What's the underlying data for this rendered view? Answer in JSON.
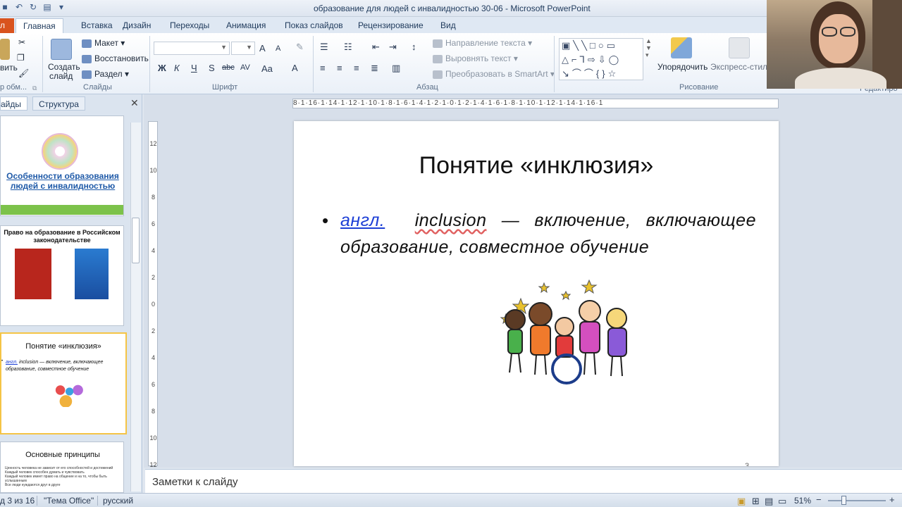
{
  "window": {
    "title": "образование для людей с инвалидностью 30-06  -  Microsoft PowerPoint"
  },
  "tabs": [
    {
      "label": "Главная"
    },
    {
      "label": "Вставка"
    },
    {
      "label": "Дизайн"
    },
    {
      "label": "Переходы"
    },
    {
      "label": "Анимация"
    },
    {
      "label": "Показ слайдов"
    },
    {
      "label": "Рецензирование"
    },
    {
      "label": "Вид"
    }
  ],
  "file_tab": {
    "label": "л"
  },
  "ribbon": {
    "clipboard": {
      "paste_label": "вить",
      "group_label": "р обм..."
    },
    "slides": {
      "create_label": "Создать",
      "create_label2": "слайд",
      "layout_label": "Макет",
      "reset_label": "Восстановить",
      "section_label": "Раздел",
      "group_label": "Слайды"
    },
    "font": {
      "group_label": "Шрифт",
      "bold": "Ж",
      "italic": "К",
      "underline": "Ч",
      "strike": "S",
      "abc": "abc",
      "spacing": "AV",
      "case": "Aa",
      "color": "A",
      "grow": "A",
      "shrink": "A"
    },
    "paragraph": {
      "direction_label": "Направление текста",
      "align_label": "Выровнять текст",
      "smartart_label": "Преобразовать в SmartArt",
      "group_label": "Абзац"
    },
    "drawing": {
      "arrange_label": "Упорядочить",
      "quick_styles_label": "Экспресс-стили",
      "group_label": "Рисование",
      "editing_label": "Редактиро"
    }
  },
  "left_pane": {
    "tab_slides": "айды",
    "tab_outline": "Структура",
    "thumbs": [
      {
        "title": "Особенности образования людей с инвалидностью"
      },
      {
        "title": "Право на образование в Российском законодательстве"
      },
      {
        "title": "Понятие «инклюзия»",
        "text_link": "англ.",
        "text_rest": "inclusion — включение, включающее образование, совместное обучение"
      },
      {
        "title": "Основные принципы",
        "lines": [
          "Ценность человека не зависит от его способностей и достижений",
          "Каждый человек способен думать и чувствовать",
          "Каждый человек имеет право на общение и на то, чтобы быть услышанным",
          "Все люди нуждаются друг в друге"
        ]
      }
    ]
  },
  "slide": {
    "title": "Понятие «инклюзия»",
    "bullet": "•",
    "text_link": "англ.",
    "text_term": "inclusion",
    "text_rest": " — включение, включающее образование, совместное обучение",
    "page_number": "3"
  },
  "notes": {
    "placeholder": "Заметки к слайду"
  },
  "status": {
    "slide_info": "д 3 из 16",
    "theme": "\"Тема Office\"",
    "language": "русский",
    "zoom": "51%",
    "zoom_out": "−",
    "zoom_in": "+"
  },
  "ruler": {
    "horizontal": "8·1·16·1·14·1·12·1·10·1·8·1·6·1·4·1·2·1·0·1·2·1·4·1·6·1·8·1·10·1·12·1·14·1·16·1",
    "vertical": "12 10 8 6 4 2 0 2 4 6 8 10 12"
  },
  "colors": {
    "file_tab": "#d9531e",
    "link": "#1d3fd6",
    "selected_thumb": "#f5c446",
    "ribbon_bg": "#ffffff"
  }
}
